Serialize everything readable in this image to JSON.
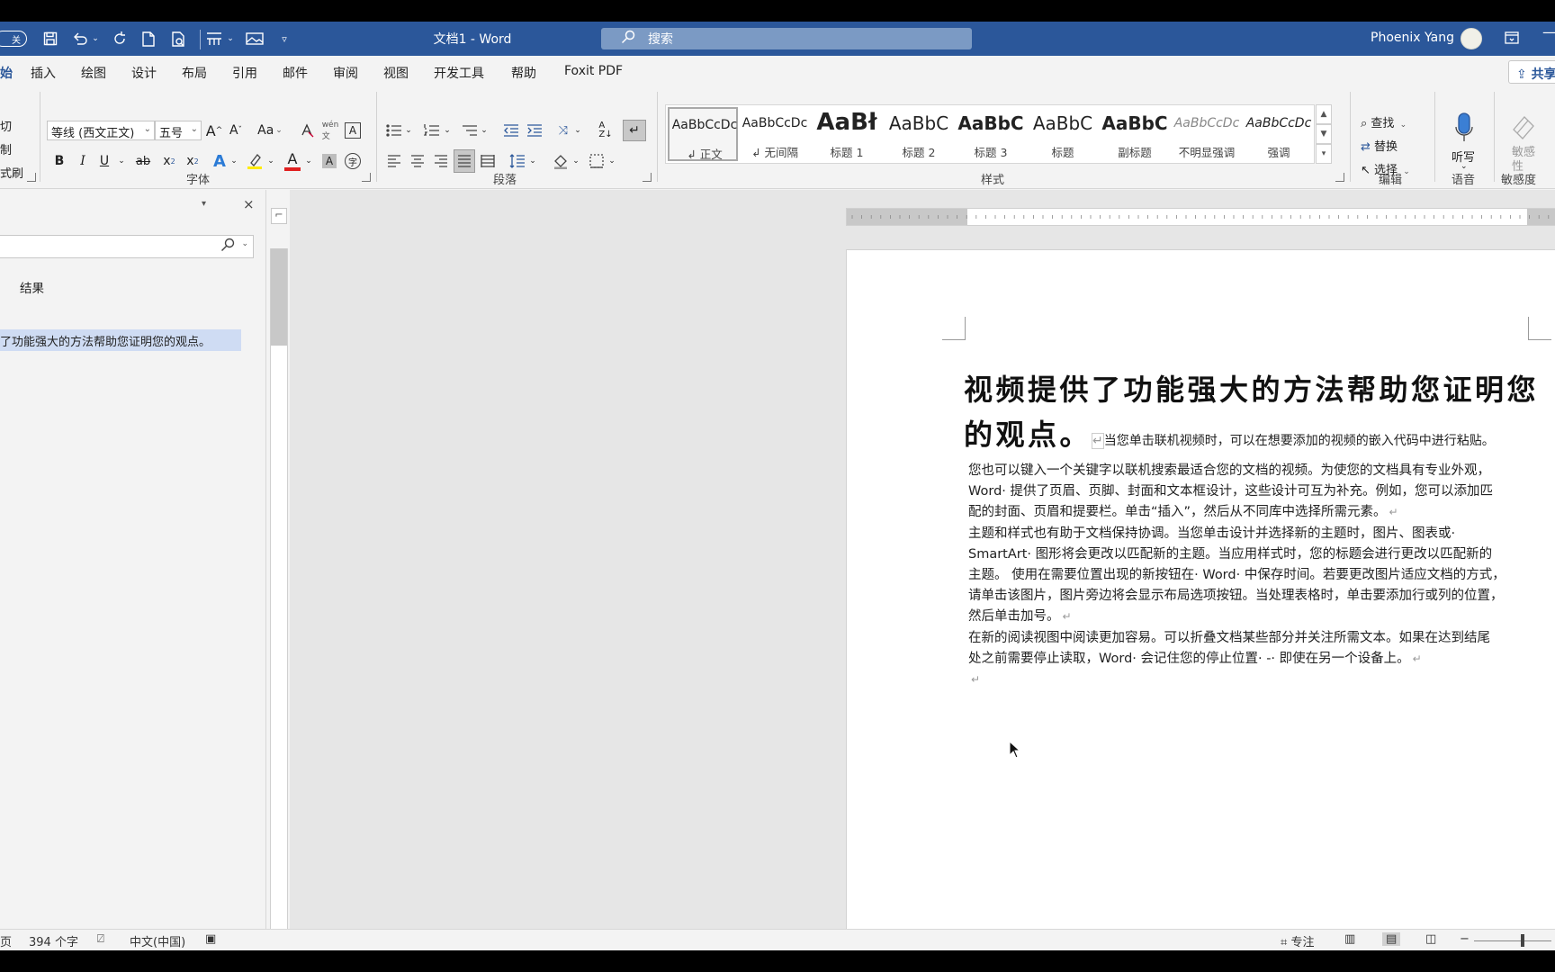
{
  "titlebar": {
    "autosave": "关",
    "doc_title": "文档1  -  Word",
    "search_placeholder": "搜索",
    "user_name": "Phoenix Yang",
    "minimize": "—"
  },
  "tabs": {
    "home_partial": "始",
    "items": [
      "插入",
      "绘图",
      "设计",
      "布局",
      "引用",
      "邮件",
      "审阅",
      "视图",
      "开发工具",
      "帮助",
      "Foxit PDF"
    ],
    "share": "共享"
  },
  "ribbon": {
    "clipboard": {
      "cut": "切",
      "copy": "制",
      "painter": "式刷"
    },
    "font": {
      "name": "等线 (西文正文)",
      "size": "五号",
      "grow": "A",
      "shrink": "A",
      "case": "Aa",
      "bold": "B",
      "italic": "I",
      "underline": "U",
      "strike": "ab",
      "sub": "x",
      "sup": "x",
      "group_label": "字体"
    },
    "paragraph": {
      "group_label": "段落"
    },
    "styles": {
      "items": [
        {
          "preview": "AaBbCcDc",
          "name": "正文"
        },
        {
          "preview": "AaBbCcDc",
          "name": "无间隔"
        },
        {
          "preview": "AaBł",
          "name": "标题 1"
        },
        {
          "preview": "AaBbC",
          "name": "标题 2"
        },
        {
          "preview": "AaBbC",
          "name": "标题 3"
        },
        {
          "preview": "AaBbC",
          "name": "标题"
        },
        {
          "preview": "AaBbC",
          "name": "副标题"
        },
        {
          "preview": "AaBbCcDc",
          "name": "不明显强调"
        },
        {
          "preview": "AaBbCcDc",
          "name": "强调"
        }
      ],
      "group_label": "样式"
    },
    "editing": {
      "find": "查找",
      "replace": "替换",
      "select": "选择",
      "group_label": "编辑"
    },
    "voice": {
      "dictate": "听写",
      "group_label": "语音"
    },
    "sensitivity": {
      "label": "敏感\n性",
      "group_label": "敏感度"
    }
  },
  "nav_pane": {
    "results_tab": "结果",
    "hit": "了功能强大的方法帮助您证明您的观点。"
  },
  "document": {
    "heading_line1": "视频提供了功能强大的方法帮助您证明您",
    "heading_line2": "的观点。",
    "inline_text": "当您单击联机视频时，可以在想要添加的视频的嵌入代码中进行粘贴。",
    "lines": [
      "您也可以键入一个关键字以联机搜索最适合您的文档的视频。为使您的文档具有专业外观，",
      "Word· 提供了页眉、页脚、封面和文本框设计，这些设计可互为补充。例如，您可以添加匹",
      "配的封面、页眉和提要栏。单击“插入”，然后从不同库中选择所需元素。",
      "主题和样式也有助于文档保持协调。当您单击设计并选择新的主题时，图片、图表或·",
      "SmartArt· 图形将会更改以匹配新的主题。当应用样式时，您的标题会进行更改以匹配新的",
      "主题。 使用在需要位置出现的新按钮在· Word· 中保存时间。若要更改图片适应文档的方式，",
      "请单击该图片，图片旁边将会显示布局选项按钮。当处理表格时，单击要添加行或列的位置，",
      "然后单击加号。",
      "在新的阅读视图中阅读更加容易。可以折叠文档某些部分并关注所需文本。如果在达到结尾",
      "处之前需要停止读取，Word· 会记住您的停止位置· -· 即使在另一个设备上。"
    ],
    "para_end_lines": [
      2,
      7,
      9
    ],
    "paragraph_mark": "↵"
  },
  "statusbar": {
    "page_partial": "页",
    "word_count": "394 个字",
    "language": "中文(中国)",
    "focus": "专注"
  },
  "colors": {
    "titlebar": "#2b579a",
    "accent": "#2b579a",
    "nav_highlight": "#cfdcf3"
  }
}
